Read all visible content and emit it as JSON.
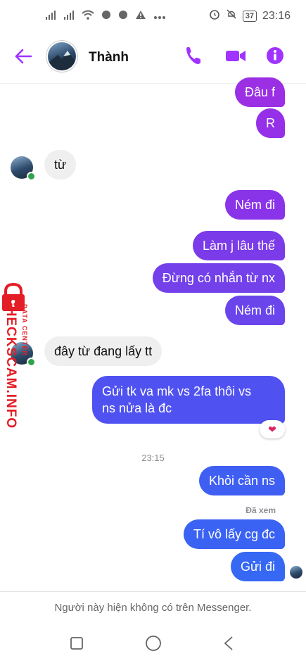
{
  "status_bar": {
    "time": "23:16",
    "battery": "37"
  },
  "header": {
    "contact_name": "Thành"
  },
  "messages": [
    {
      "text": "Đâu f"
    },
    {
      "text": "R"
    },
    {
      "text": "từ"
    },
    {
      "text": "Ném đi"
    },
    {
      "text": "Làm j lâu thế"
    },
    {
      "text": "Đừng có nhắn từ nx"
    },
    {
      "text": "Ném đi"
    },
    {
      "text": "đây từ đang lấy tt"
    },
    {
      "line1": "Gửi tk va mk vs 2fa thôi vs",
      "line2": "ns nửa là đc"
    },
    {
      "text": "Khỏi cần ns"
    },
    {
      "text": "Tí vô lấy cg đc"
    },
    {
      "text": "Gửi đi"
    }
  ],
  "timestamp": "23:15",
  "seen_label": "Đã xem",
  "reaction": "❤",
  "watermark": {
    "title": "CHECKSCAM.INFO",
    "subtitle": "DATA CENTER"
  },
  "footer_text": "Người này hiện không có trên Messenger.",
  "colors": {
    "accent": "#a033ff",
    "bubble_purple": "#8a2be2",
    "bubble_blue": "#3b5bf5",
    "watermark_red": "#e41e26"
  }
}
